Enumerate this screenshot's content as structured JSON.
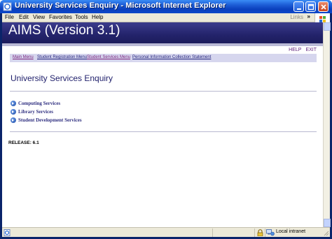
{
  "window": {
    "title": "University Services Enquiry - Microsoft Internet Explorer"
  },
  "menubar": {
    "items": [
      "File",
      "Edit",
      "View",
      "Favorites",
      "Tools",
      "Help"
    ],
    "links_label": "Links",
    "links_chevron": "»"
  },
  "banner": {
    "title": "AIMS (Version 3.1)"
  },
  "top_links": {
    "help": "HELP",
    "exit": "EXIT"
  },
  "nav": {
    "items": [
      {
        "label": "Main Menu",
        "color": "#7a1f7a"
      },
      {
        "label": "Student Registration Menu",
        "color": "#1f1f7a"
      },
      {
        "label": "Student Services Menu",
        "color": "#7a1f7a"
      },
      {
        "label": "Personal Information Collection Statement",
        "color": "#1f1f7a"
      }
    ]
  },
  "page": {
    "title": "University Services Enquiry",
    "services": [
      {
        "label": "Computing Services"
      },
      {
        "label": "Library Services"
      },
      {
        "label": "Student Development Services"
      }
    ],
    "release": "RELEASE: 6.1"
  },
  "statusbar": {
    "zone": "Local intranet"
  },
  "colors": {
    "banner": "#23236b",
    "nav_bg": "#d6d6ee",
    "link_visited": "#7a1f7a",
    "link": "#1f1f7a"
  }
}
